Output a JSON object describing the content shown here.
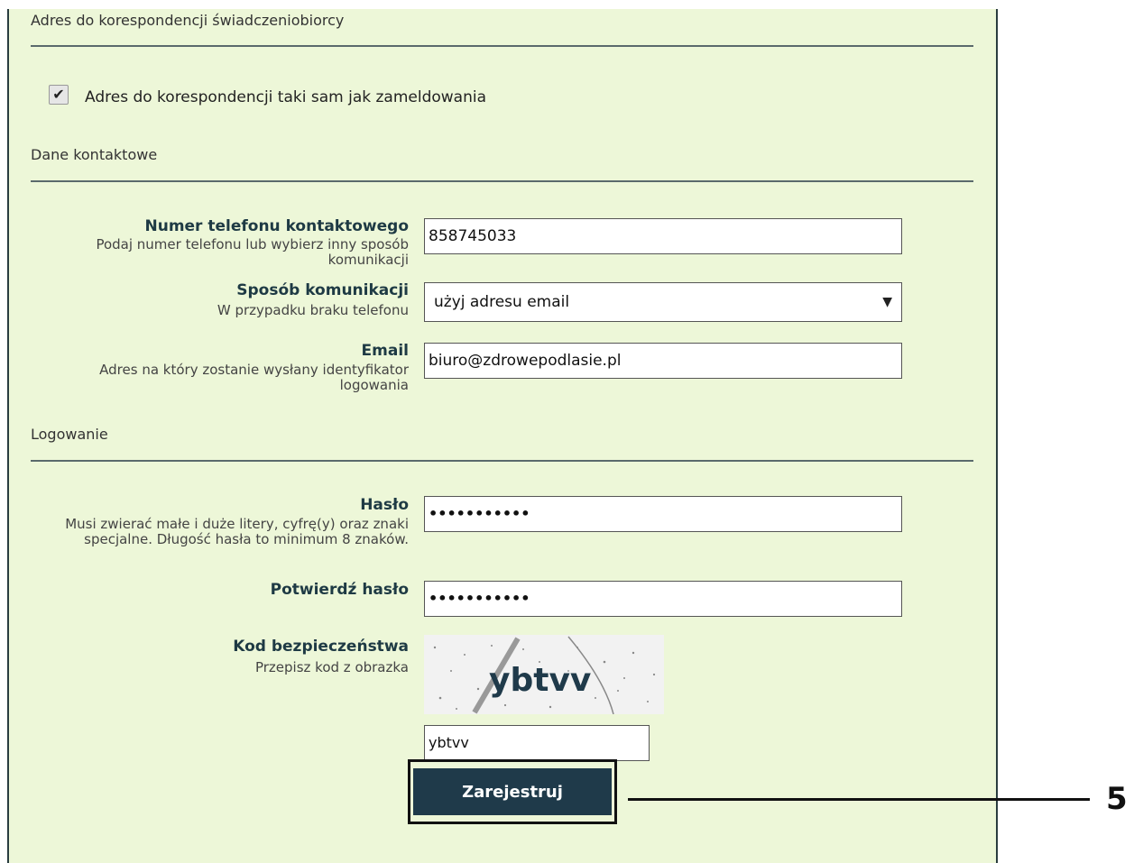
{
  "sections": {
    "correspondence_title": "Adres do korespondencji świadczeniobiorcy",
    "contact_title": "Dane kontaktowe",
    "login_title": "Logowanie"
  },
  "checkbox": {
    "label": "Adres do korespondencji taki sam jak zameldowania",
    "checked": true,
    "mark": "✔"
  },
  "phone": {
    "label": "Numer telefonu kontaktowego",
    "hint": "Podaj numer telefonu lub wybierz inny sposób komunikacji",
    "value": "858745033"
  },
  "communication": {
    "label": "Sposób komunikacji",
    "hint": "W przypadku braku telefonu",
    "selected": "użyj adresu email",
    "arrow": "▼"
  },
  "email": {
    "label": "Email",
    "hint": "Adres na który zostanie wysłany identyfikator logowania",
    "value": "biuro@zdrowepodlasie.pl"
  },
  "password": {
    "label": "Hasło",
    "hint": "Musi zwierać małe i duże litery, cyfrę(y) oraz znaki specjalne. Długość hasła to minimum 8 znaków.",
    "masked": "•••••••••••"
  },
  "confirm_password": {
    "label": "Potwierdź hasło",
    "masked": "•••••••••••"
  },
  "captcha": {
    "label": "Kod bezpieczeństwa",
    "hint": "Przepisz kod z obrazka",
    "image_text": "ybtvv",
    "input_value": "ybtvv"
  },
  "submit": {
    "label": "Zarejestruj"
  },
  "callout": {
    "number": "5"
  },
  "colors": {
    "panel_bg": "#edf7d8",
    "button_bg": "#1f3a4a",
    "label_color": "#1e3a44"
  }
}
